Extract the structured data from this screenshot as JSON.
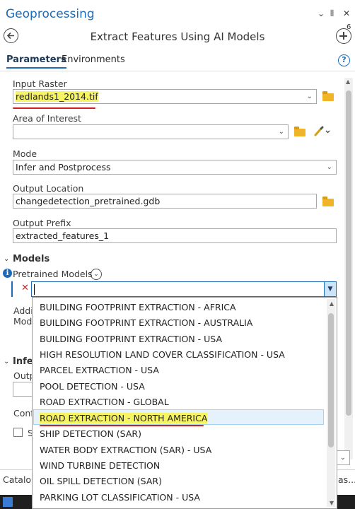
{
  "pane": {
    "title": "Geoprocessing",
    "controls": {
      "menu": "⌄",
      "pin": "⫴",
      "close": "✕"
    }
  },
  "tool": {
    "title": "Extract Features Using AI Models",
    "add_count": "6"
  },
  "tabs": [
    {
      "label": "Parameters",
      "active": true
    },
    {
      "label": "Environments",
      "active": false
    }
  ],
  "params": {
    "input_raster": {
      "label": "Input Raster",
      "value": "redlands1_2014.tif"
    },
    "area_of_interest": {
      "label": "Area of Interest",
      "value": ""
    },
    "mode": {
      "label": "Mode",
      "value": "Infer and Postprocess"
    },
    "output_location": {
      "label": "Output Location",
      "value": "changedetection_pretrained.gdb"
    },
    "output_prefix": {
      "label": "Output Prefix",
      "value": "extracted_features_1"
    }
  },
  "models_section": {
    "label": "Models",
    "pretrained_label": "Pretrained Models",
    "combo_value": ""
  },
  "dropdown": {
    "items": [
      "BUILDING FOOTPRINT EXTRACTION - AFRICA",
      "BUILDING FOOTPRINT EXTRACTION - AUSTRALIA",
      "BUILDING FOOTPRINT EXTRACTION - USA",
      "HIGH RESOLUTION LAND COVER CLASSIFICATION - USA",
      "PARCEL EXTRACTION - USA",
      "POOL DETECTION - USA",
      "ROAD EXTRACTION - GLOBAL",
      "ROAD EXTRACTION - NORTH AMERICA",
      "SHIP DETECTION (SAR)",
      "WATER BODY EXTRACTION (SAR) - USA",
      "WIND TURBINE DETECTION",
      "OIL SPILL DETECTION (SAR)",
      "PARKING LOT CLASSIFICATION - USA"
    ],
    "selected_index": 7
  },
  "hidden_fragments": {
    "addi": "Addi",
    "mod": "Mod",
    "infer": "Infe",
    "outp": "Outp",
    "conf": "Conf",
    "s": "S",
    "catalog": "Catalo",
    "as": "as..."
  },
  "colors": {
    "accent": "#1e6bb8",
    "highlight": "#f7f463",
    "annotation": "#d51e1e",
    "folder": "#f0b429"
  }
}
